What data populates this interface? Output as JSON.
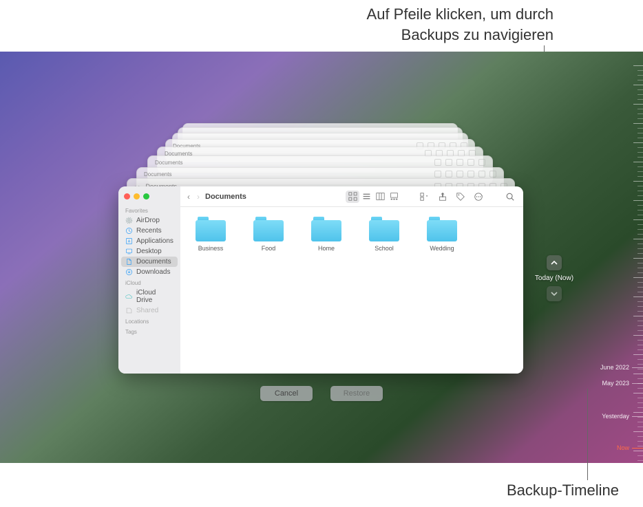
{
  "callouts": {
    "top_line1": "Auf Pfeile klicken, um durch",
    "top_line2": "Backups zu navigieren",
    "bottom": "Backup-Timeline"
  },
  "nav": {
    "now_label": "Today (Now)"
  },
  "timeline": {
    "labels": [
      {
        "text": "June 2022",
        "pos": 459
      },
      {
        "text": "May 2023",
        "pos": 482
      },
      {
        "text": "Yesterday",
        "pos": 530
      },
      {
        "text": "Now",
        "pos": 576,
        "now": true
      }
    ]
  },
  "finder": {
    "title": "Documents",
    "ghost_title": "Documents",
    "sidebar": {
      "favorites_head": "Favorites",
      "items_fav": [
        {
          "icon": "airdrop",
          "label": "AirDrop"
        },
        {
          "icon": "recents",
          "label": "Recents"
        },
        {
          "icon": "apps",
          "label": "Applications"
        },
        {
          "icon": "desktop",
          "label": "Desktop"
        },
        {
          "icon": "documents",
          "label": "Documents",
          "selected": true
        },
        {
          "icon": "downloads",
          "label": "Downloads"
        }
      ],
      "icloud_head": "iCloud",
      "items_icloud": [
        {
          "icon": "icloud",
          "label": "iCloud Drive"
        },
        {
          "icon": "shared",
          "label": "Shared"
        }
      ],
      "locations_head": "Locations",
      "tags_head": "Tags"
    },
    "folders": [
      {
        "name": "Business"
      },
      {
        "name": "Food"
      },
      {
        "name": "Home"
      },
      {
        "name": "School"
      },
      {
        "name": "Wedding"
      }
    ]
  },
  "buttons": {
    "cancel": "Cancel",
    "restore": "Restore"
  }
}
